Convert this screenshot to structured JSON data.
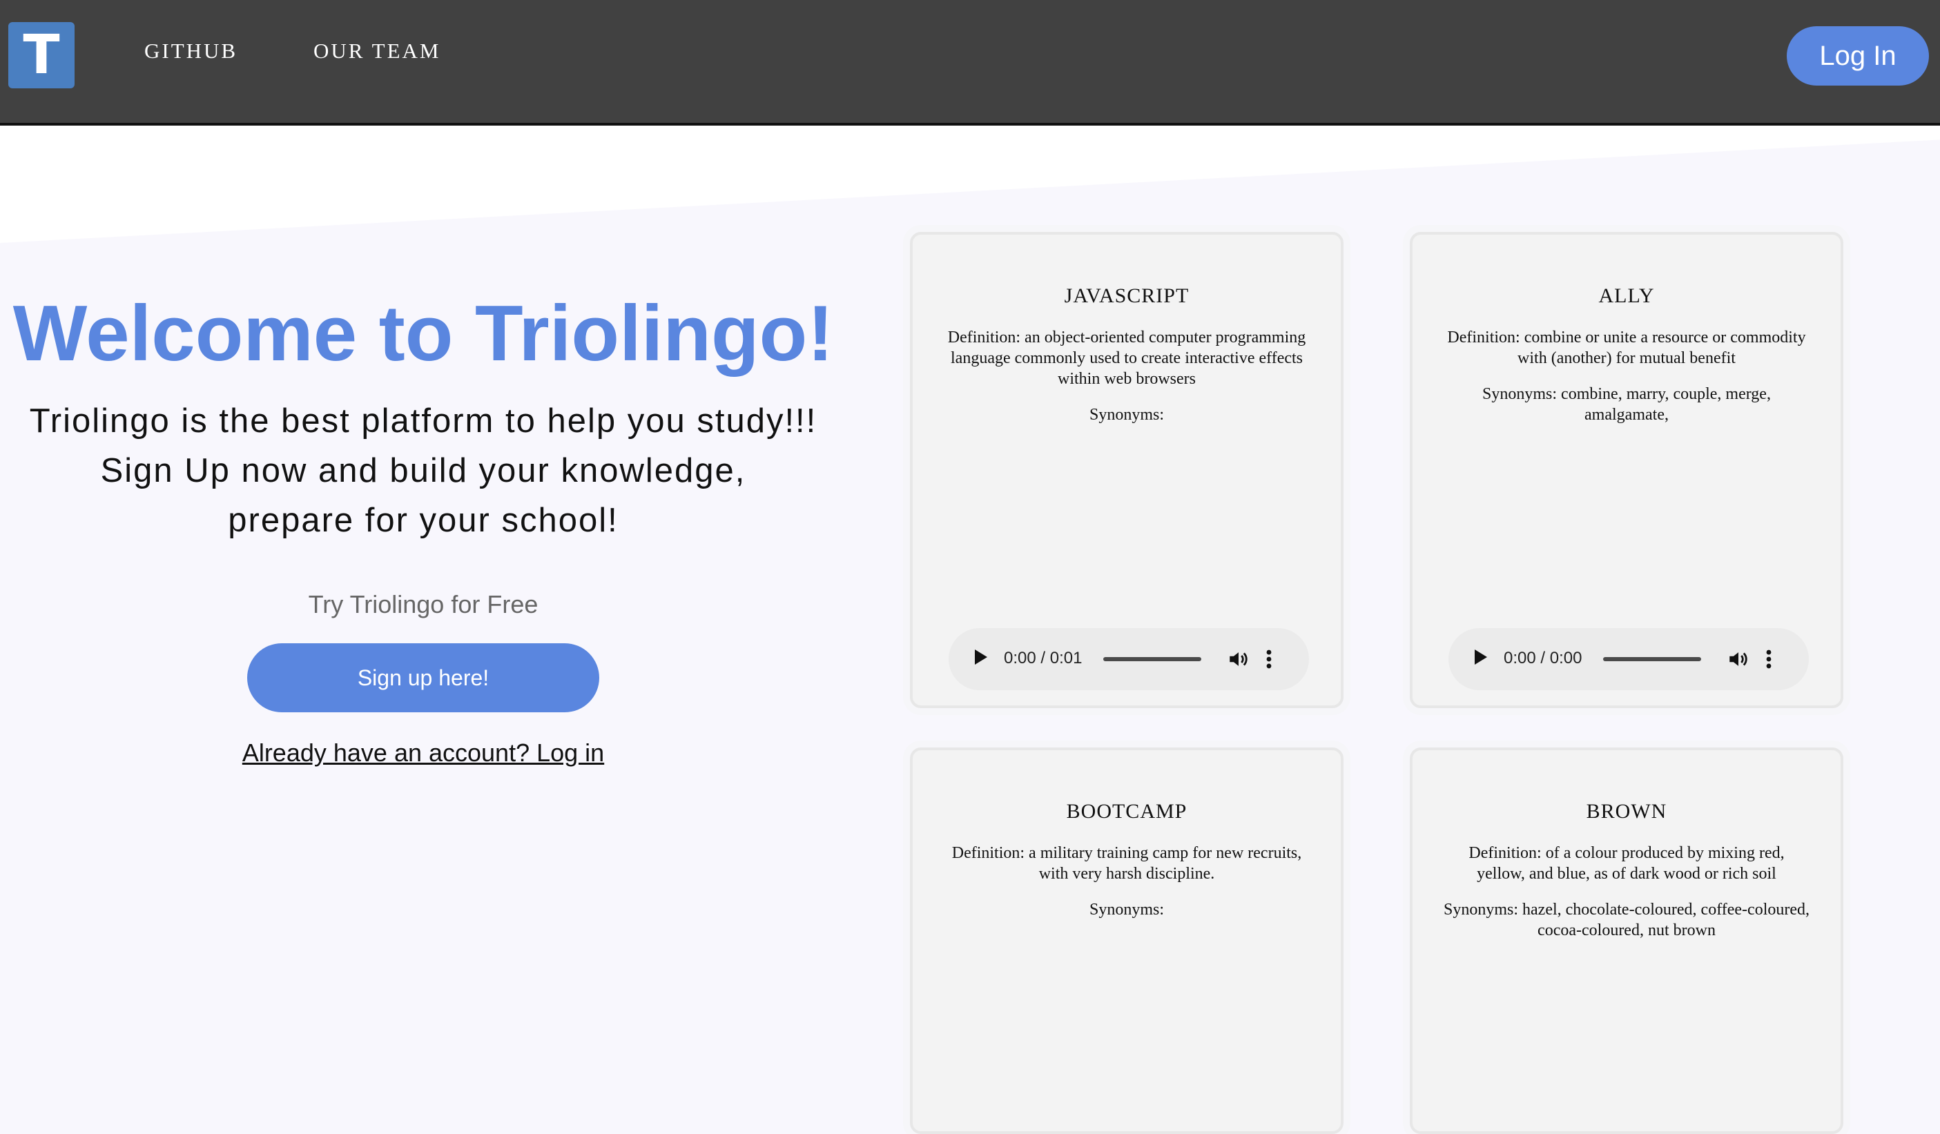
{
  "nav": {
    "logo_letter": "T",
    "links": [
      "GITHUB",
      "OUR TEAM"
    ],
    "login_label": "Log In"
  },
  "hero": {
    "title": "Welcome to Triolingo!",
    "subtitle_lines": [
      "Triolingo is the best platform to help you study!!!",
      "Sign Up now and build your knowledge,",
      "prepare for your school!"
    ],
    "try_text": "Try Triolingo for Free",
    "signup_label": "Sign up here!",
    "login_link": "Already have an account? Log in"
  },
  "cards": [
    {
      "word": "JAVASCRIPT",
      "definition": "Definition: an object-oriented computer programming language commonly used to create interactive effects within web browsers",
      "synonyms": "Synonyms:",
      "audio_time": "0:00 / 0:01"
    },
    {
      "word": "ALLY",
      "definition": "Definition: combine or unite a resource or commodity with (another) for mutual benefit",
      "synonyms": "Synonyms: combine, marry, couple, merge, amalgamate,",
      "audio_time": "0:00 / 0:00"
    },
    {
      "word": "BOOTCAMP",
      "definition": "Definition: a military training camp for new recruits, with very harsh discipline.",
      "synonyms": "Synonyms:",
      "audio_time": ""
    },
    {
      "word": "BROWN",
      "definition": "Definition: of a colour produced by mixing red, yellow, and blue, as of dark wood or rich soil",
      "synonyms": "Synonyms: hazel, chocolate-coloured, coffee-coloured, cocoa-coloured, nut brown",
      "audio_time": ""
    }
  ],
  "colors": {
    "accent": "#5a86df",
    "navbar": "#414141",
    "logo": "#4a7fc1"
  }
}
